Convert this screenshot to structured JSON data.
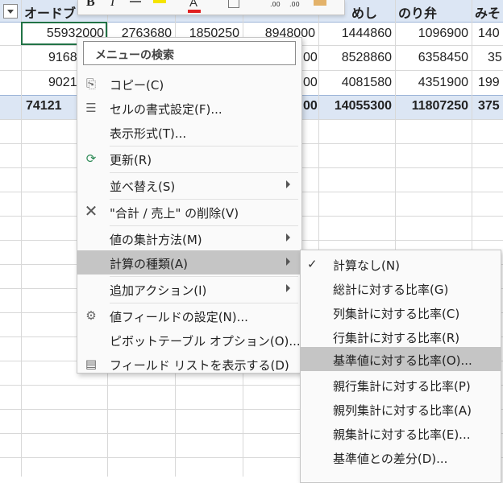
{
  "sheet": {
    "header_row": {
      "col1": "オードブ",
      "col_meshi": "めし",
      "col_noriben": "のり弁",
      "col_miso": "みそ"
    },
    "rows": [
      [
        "55932000",
        "2763680",
        "1850250",
        "8948000",
        "1444860",
        "1096900",
        "140"
      ],
      [
        "9168",
        "00",
        "8528860",
        "6358450",
        "35"
      ],
      [
        "9021",
        "00",
        "4081580",
        "4351900",
        "199"
      ]
    ],
    "total_row": [
      "74121",
      "00",
      "14055300",
      "11807250",
      "375"
    ]
  },
  "mini_toolbar": {
    "bold": "B",
    "italic": "I",
    "font_color_glyph": "A",
    "inc_decimal": ".00",
    "dec_decimal": ".00"
  },
  "context_menu": {
    "search_placeholder": "メニューの検索",
    "items": [
      {
        "label": "コピー(C)",
        "icon": "copy-icon"
      },
      {
        "label": "セルの書式設定(F)...",
        "icon": "format-cells-icon"
      },
      {
        "label": "表示形式(T)...",
        "icon": ""
      },
      {
        "label": "更新(R)",
        "icon": "refresh-icon"
      },
      {
        "label": "並べ替え(S)",
        "icon": "",
        "submenu": true
      },
      {
        "label": "\"合計 / 売上\" の削除(V)",
        "icon": "delete-x-icon"
      },
      {
        "label": "値の集計方法(M)",
        "icon": "",
        "submenu": true
      },
      {
        "label": "計算の種類(A)",
        "icon": "",
        "submenu": true,
        "highlighted": true
      },
      {
        "label": "追加アクション(I)",
        "icon": "",
        "submenu": true
      },
      {
        "label": "値フィールドの設定(N)...",
        "icon": "field-settings-icon"
      },
      {
        "label": "ピボットテーブル オプション(O)...",
        "icon": ""
      },
      {
        "label": "フィールド リストを表示する(D)",
        "icon": "field-list-icon"
      }
    ]
  },
  "submenu": {
    "items": [
      {
        "label": "計算なし(N)",
        "checked": true
      },
      {
        "label": "総計に対する比率(G)"
      },
      {
        "label": "列集計に対する比率(C)"
      },
      {
        "label": "行集計に対する比率(R)"
      },
      {
        "label": "基準値に対する比率(O)...",
        "highlighted": true
      },
      {
        "label": "親行集計に対する比率(P)"
      },
      {
        "label": "親列集計に対する比率(A)"
      },
      {
        "label": "親集計に対する比率(E)..."
      },
      {
        "label": "基準値との差分(D)..."
      }
    ]
  }
}
